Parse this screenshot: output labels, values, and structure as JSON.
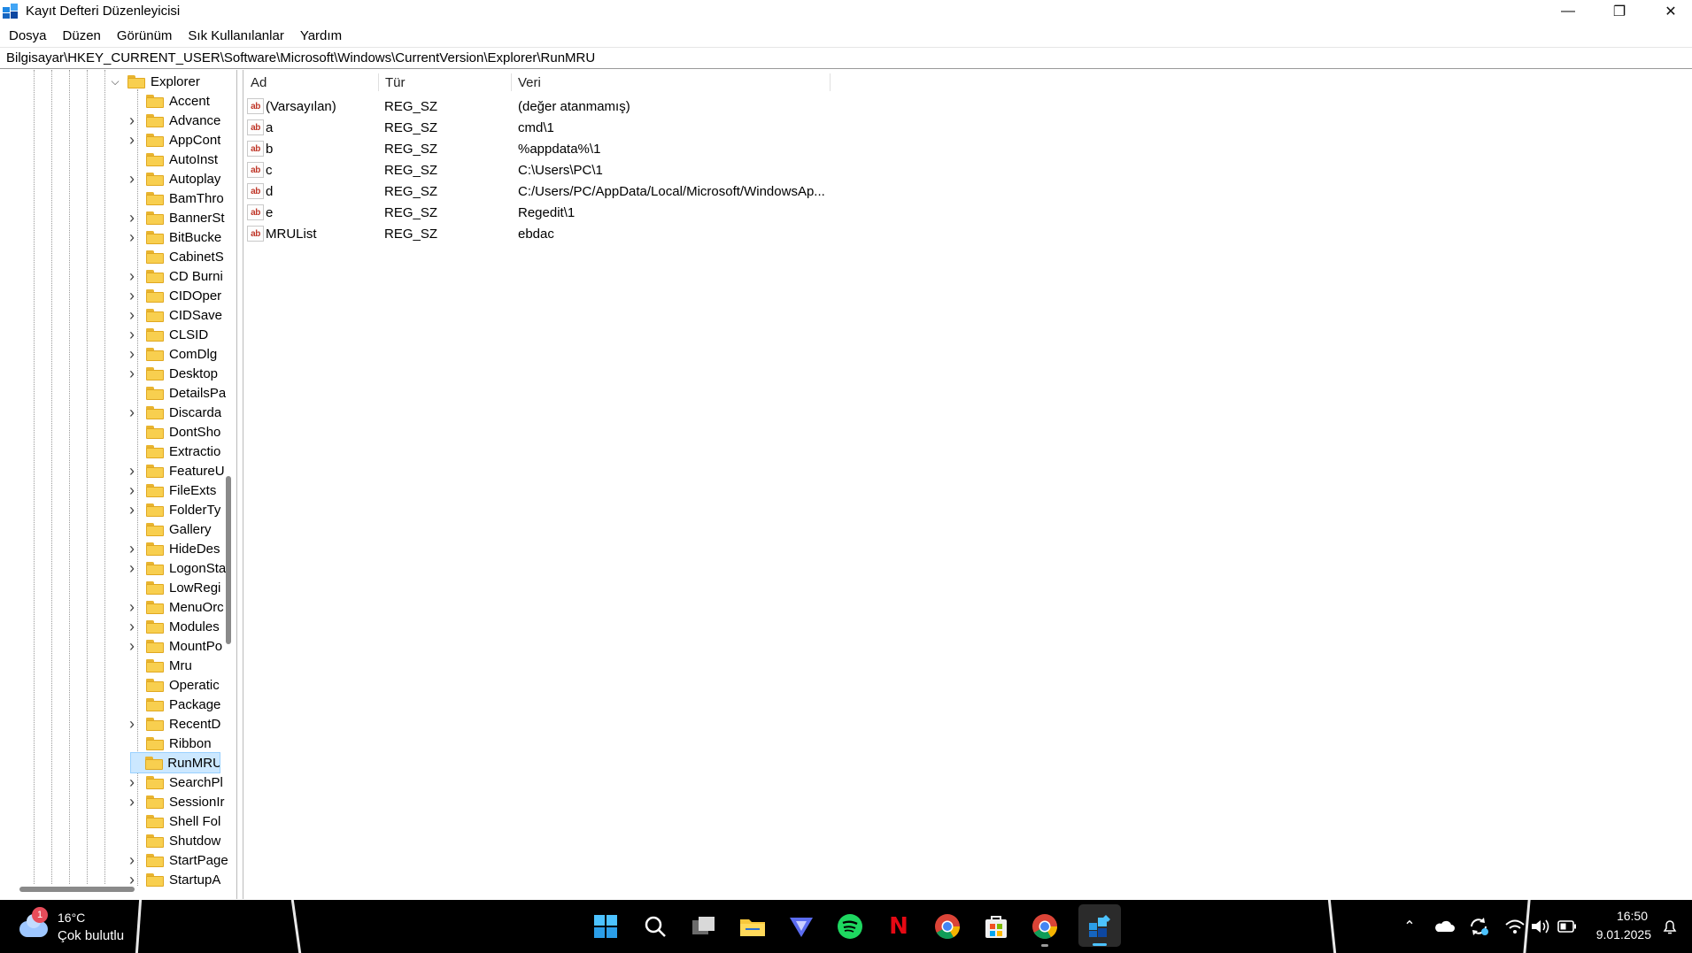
{
  "window": {
    "title": "Kayıt Defteri Düzenleyicisi",
    "minimize_glyph": "—",
    "maximize_glyph": "❐",
    "close_glyph": "✕"
  },
  "menu": [
    "Dosya",
    "Düzen",
    "Görünüm",
    "Sık Kullanılanlar",
    "Yardım"
  ],
  "address": "Bilgisayar\\HKEY_CURRENT_USER\\Software\\Microsoft\\Windows\\CurrentVersion\\Explorer\\RunMRU",
  "tree": {
    "parent": "Explorer",
    "items": [
      {
        "label": "Accent",
        "expandable": false
      },
      {
        "label": "Advance",
        "expandable": true
      },
      {
        "label": "AppCont",
        "expandable": true
      },
      {
        "label": "AutoInst",
        "expandable": false
      },
      {
        "label": "Autoplay",
        "expandable": true
      },
      {
        "label": "BamThro",
        "expandable": false
      },
      {
        "label": "BannerSt",
        "expandable": true
      },
      {
        "label": "BitBucke",
        "expandable": true
      },
      {
        "label": "CabinetS",
        "expandable": false
      },
      {
        "label": "CD Burni",
        "expandable": true
      },
      {
        "label": "CIDOper",
        "expandable": true
      },
      {
        "label": "CIDSave",
        "expandable": true
      },
      {
        "label": "CLSID",
        "expandable": true
      },
      {
        "label": "ComDlg",
        "expandable": true
      },
      {
        "label": "Desktop",
        "expandable": true
      },
      {
        "label": "DetailsPa",
        "expandable": false
      },
      {
        "label": "Discarda",
        "expandable": true
      },
      {
        "label": "DontSho",
        "expandable": false
      },
      {
        "label": "Extractio",
        "expandable": false
      },
      {
        "label": "FeatureU",
        "expandable": true
      },
      {
        "label": "FileExts",
        "expandable": true
      },
      {
        "label": "FolderTy",
        "expandable": true
      },
      {
        "label": "Gallery",
        "expandable": false
      },
      {
        "label": "HideDes",
        "expandable": true
      },
      {
        "label": "LogonSta",
        "expandable": true
      },
      {
        "label": "LowRegi",
        "expandable": false
      },
      {
        "label": "MenuOrc",
        "expandable": true
      },
      {
        "label": "Modules",
        "expandable": true
      },
      {
        "label": "MountPo",
        "expandable": true
      },
      {
        "label": "Mru",
        "expandable": false
      },
      {
        "label": "Operatic",
        "expandable": false
      },
      {
        "label": "Package",
        "expandable": false
      },
      {
        "label": "RecentD",
        "expandable": true
      },
      {
        "label": "Ribbon",
        "expandable": false
      },
      {
        "label": "RunMRU",
        "expandable": false,
        "selected": true
      },
      {
        "label": "SearchPl",
        "expandable": true
      },
      {
        "label": "SessionIr",
        "expandable": true
      },
      {
        "label": "Shell Fol",
        "expandable": false
      },
      {
        "label": "Shutdow",
        "expandable": false
      },
      {
        "label": "StartPage",
        "expandable": true
      },
      {
        "label": "StartupA",
        "expandable": true
      }
    ]
  },
  "list": {
    "headers": {
      "name": "Ad",
      "type": "Tür",
      "data": "Veri"
    },
    "rows": [
      {
        "name": "(Varsayılan)",
        "type": "REG_SZ",
        "data": "(değer atanmamış)"
      },
      {
        "name": "a",
        "type": "REG_SZ",
        "data": "cmd\\1"
      },
      {
        "name": "b",
        "type": "REG_SZ",
        "data": "%appdata%\\1"
      },
      {
        "name": "c",
        "type": "REG_SZ",
        "data": "C:\\Users\\PC\\1"
      },
      {
        "name": "d",
        "type": "REG_SZ",
        "data": "C:/Users/PC/AppData/Local/Microsoft/WindowsAp..."
      },
      {
        "name": "e",
        "type": "REG_SZ",
        "data": "Regedit\\1"
      },
      {
        "name": "MRUList",
        "type": "REG_SZ",
        "data": "ebdac"
      }
    ],
    "value_icon_text": "ab"
  },
  "taskbar": {
    "weather_badge": "1",
    "weather_temp": "16°C",
    "weather_desc": "Çok bulutlu",
    "time": "16:50",
    "date": "9.01.2025",
    "netflix_letter": "N",
    "tray_chevron": "⌃"
  },
  "colors": {
    "selection": "#cce8ff",
    "folder": "#f8cf4f",
    "taskbar": "#000000",
    "accent": "#0067c0"
  }
}
